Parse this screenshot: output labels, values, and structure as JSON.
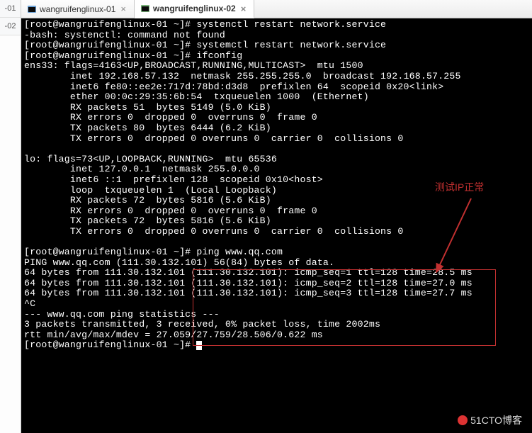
{
  "gutter": {
    "items": [
      "-01",
      "-02"
    ]
  },
  "tabs": [
    {
      "label": "wangruifenglinux-01",
      "active": false
    },
    {
      "label": "wangruifenglinux-02",
      "active": true
    }
  ],
  "terminal": {
    "lines": [
      "[root@wangruifenglinux-01 ~]# systenctl restart network.service",
      "-bash: systenctl: command not found",
      "[root@wangruifenglinux-01 ~]# systemctl restart network.service",
      "[root@wangruifenglinux-01 ~]# ifconfig",
      "ens33: flags=4163<UP,BROADCAST,RUNNING,MULTICAST>  mtu 1500",
      "        inet 192.168.57.132  netmask 255.255.255.0  broadcast 192.168.57.255",
      "        inet6 fe80::ee2e:717d:78bd:d3d8  prefixlen 64  scopeid 0x20<link>",
      "        ether 00:0c:29:35:6b:54  txqueuelen 1000  (Ethernet)",
      "        RX packets 51  bytes 5149 (5.0 KiB)",
      "        RX errors 0  dropped 0  overruns 0  frame 0",
      "        TX packets 80  bytes 6444 (6.2 KiB)",
      "        TX errors 0  dropped 0 overruns 0  carrier 0  collisions 0",
      "",
      "lo: flags=73<UP,LOOPBACK,RUNNING>  mtu 65536",
      "        inet 127.0.0.1  netmask 255.0.0.0",
      "        inet6 ::1  prefixlen 128  scopeid 0x10<host>",
      "        loop  txqueuelen 1  (Local Loopback)",
      "        RX packets 72  bytes 5816 (5.6 KiB)",
      "        RX errors 0  dropped 0  overruns 0  frame 0",
      "        TX packets 72  bytes 5816 (5.6 KiB)",
      "        TX errors 0  dropped 0 overruns 0  carrier 0  collisions 0",
      "",
      "[root@wangruifenglinux-01 ~]# ping www.qq.com",
      "PING www.qq.com (111.30.132.101) 56(84) bytes of data.",
      "64 bytes from 111.30.132.101 (111.30.132.101): icmp_seq=1 ttl=128 time=28.5 ms",
      "64 bytes from 111.30.132.101 (111.30.132.101): icmp_seq=2 ttl=128 time=27.0 ms",
      "64 bytes from 111.30.132.101 (111.30.132.101): icmp_seq=3 ttl=128 time=27.7 ms",
      "^C",
      "--- www.qq.com ping statistics ---",
      "3 packets transmitted, 3 received, 0% packet loss, time 2002ms",
      "rtt min/avg/max/mdev = 27.059/27.759/28.506/0.622 ms",
      "[root@wangruifenglinux-01 ~]# "
    ]
  },
  "annotation": {
    "label": "测试IP正常",
    "box_color": "#c23030",
    "arrow_color": "#c23030"
  },
  "watermark": "51CTO博客"
}
